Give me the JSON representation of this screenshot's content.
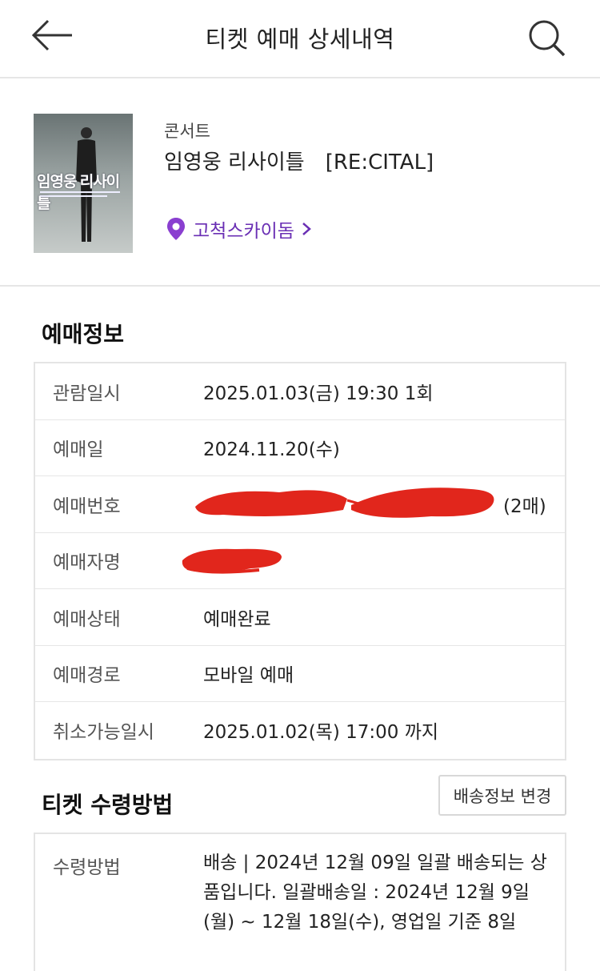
{
  "header": {
    "title": "티켓 예매 상세내역",
    "back_icon": "arrow-left-icon",
    "search_icon": "search-icon"
  },
  "event": {
    "poster_text": "임영웅 리사이틀",
    "category": "콘서트",
    "name": "임영웅 리사이틀　[RE:CITAL]",
    "venue": "고척스카이돔",
    "venue_icon": "map-pin-icon",
    "accent_color": "#7b3fc4"
  },
  "reservation": {
    "title": "예매정보",
    "rows": [
      {
        "label": "관람일시",
        "value": "2025.01.03(금) 19:30 1회"
      },
      {
        "label": "예매일",
        "value": "2024.11.20(수)"
      },
      {
        "label": "예매번호",
        "value": "",
        "suffix": "(2매)",
        "redacted": true
      },
      {
        "label": "예매자명",
        "value": "",
        "redacted": true
      },
      {
        "label": "예매상태",
        "value": "예매완료"
      },
      {
        "label": "예매경로",
        "value": "모바일 예매"
      },
      {
        "label": "취소가능일시",
        "value": "2025.01.02(목) 17:00 까지"
      }
    ]
  },
  "ticket_receive": {
    "title": "티켓 수령방법",
    "change_button": "배송정보 변경",
    "method_label": "수령방법",
    "method_value": "배송 | 2024년 12월 09일 일괄 배송되는 상품입니다. 일괄배송일 : 2024년 12월 9일(월) ~ 12월 18일(수), 영업일 기준 8일"
  },
  "redaction_color": "#e1261c"
}
